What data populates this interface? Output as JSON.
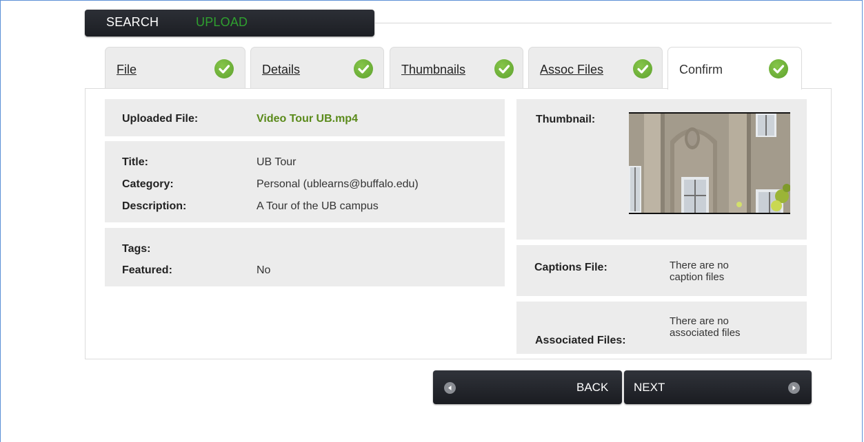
{
  "nav": {
    "search_label": "SEARCH",
    "upload_label": "UPLOAD"
  },
  "tabs": [
    {
      "label": "File",
      "complete": true
    },
    {
      "label": "Details",
      "complete": true
    },
    {
      "label": "Thumbnails",
      "complete": true
    },
    {
      "label": "Assoc Files",
      "complete": true
    },
    {
      "label": "Confirm",
      "complete": true,
      "active": true
    }
  ],
  "summary": {
    "uploaded_file_label": "Uploaded File:",
    "uploaded_file_value": "Video Tour UB.mp4",
    "title_label": "Title:",
    "title_value": "UB Tour",
    "category_label": "Category:",
    "category_value": "Personal (ublearns@buffalo.edu)",
    "description_label": "Description:",
    "description_value": "A Tour of the UB campus",
    "tags_label": "Tags:",
    "tags_value": "",
    "featured_label": "Featured:",
    "featured_value": "No",
    "thumbnail_label": "Thumbnail:",
    "captions_label": "Captions File:",
    "captions_value_line1": "There are no",
    "captions_value_line2": "caption files",
    "associated_label": "Associated Files:",
    "associated_value_line1": "There are no",
    "associated_value_line2": "associated files"
  },
  "buttons": {
    "back_label": "BACK",
    "next_label": "NEXT"
  },
  "colors": {
    "accent_green": "#5a8a1a",
    "nav_upload_green": "#2fa02f",
    "check_green": "#6cb33a",
    "dark_button": "#1f2126"
  }
}
